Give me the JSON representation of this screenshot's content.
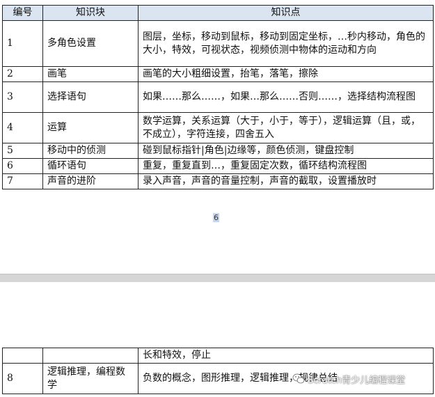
{
  "page1": {
    "headers": [
      "编号",
      "知识块",
      "知识点"
    ],
    "rows": [
      {
        "no": "1",
        "block": "多角色设置",
        "points": "图层，坐标，移动到鼠标，移动到固定坐标，…秒内移动，角色的大小，特效，可视状态，视频侦测中物体的运动和方向"
      },
      {
        "no": "2",
        "block": "画笔",
        "points": "画笔的大小粗细设置，抬笔，落笔，擦除"
      },
      {
        "no": "3",
        "block": "选择语句",
        "points": "如果……那么……，如果…那么……否则……，选择结构流程图"
      },
      {
        "no": "4",
        "block": "运算",
        "points": "数学运算，关系运算（大于，小于，等于），逻辑运算（且，或，不成立），字符连接，四舍五入"
      },
      {
        "no": "5",
        "block": "移动中的侦测",
        "points": "碰到鼠标指针|角色|边缘等，颜色侦测，键盘控制"
      },
      {
        "no": "6",
        "block": "循环语句",
        "points": "重复，重复直到…，重复固定次数，循环结构流程图"
      },
      {
        "no": "7",
        "block": "声音的进阶",
        "points": "录入声音，声音的音量控制，声音的截取，设置播放时"
      }
    ],
    "page_number": "6"
  },
  "page2": {
    "rows": [
      {
        "no": "",
        "block": "",
        "points": "长和特效，停止"
      },
      {
        "no": "8",
        "block": "逻辑推理，编程数学",
        "points": "负数的概念，图形推理，逻辑推理，规律总结"
      }
    ]
  },
  "watermark": {
    "text": "Scratch青少儿编程课堂",
    "icon": "wechat-icon"
  }
}
